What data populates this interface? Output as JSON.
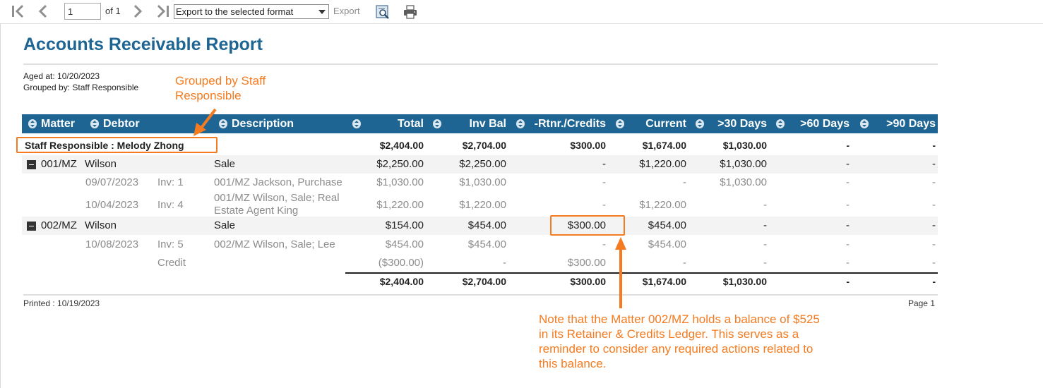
{
  "toolbar": {
    "page_value": "1",
    "of_pages": "of 1",
    "export_format": "Export to the selected format",
    "export_label": "Export"
  },
  "report": {
    "title": "Accounts Receivable Report",
    "aged_at": "Aged at: 10/20/2023",
    "grouped_by": "Grouped by: Staff Responsible"
  },
  "columns": [
    "Matter",
    "Debtor",
    "Description",
    "Total",
    "Inv Bal",
    "-Rtnr./Credits",
    "Current",
    ">30 Days",
    ">60 Days",
    ">90 Days"
  ],
  "group": {
    "label": "Staff Responsible : Melody Zhong",
    "values": [
      "$2,404.00",
      "$2,704.00",
      "$300.00",
      "$1,674.00",
      "$1,030.00",
      "-",
      "-"
    ]
  },
  "matters": [
    {
      "matter": "001/MZ",
      "debtor": "Wilson",
      "description": "Sale",
      "values": [
        "$2,250.00",
        "$2,250.00",
        "-",
        "$1,220.00",
        "$1,030.00",
        "-",
        "-"
      ],
      "lines": [
        {
          "date": "09/07/2023",
          "inv": "Inv: 1",
          "description": [
            "001/MZ Jackson, Purchase"
          ],
          "values": [
            "$1,030.00",
            "$1,030.00",
            "-",
            "-",
            "$1,030.00",
            "-",
            "-"
          ]
        },
        {
          "date": "10/04/2023",
          "inv": "Inv: 4",
          "description": [
            "001/MZ Wilson, Sale; Real",
            "Estate Agent King"
          ],
          "values": [
            "$1,220.00",
            "$1,220.00",
            "-",
            "$1,220.00",
            "-",
            "-",
            "-"
          ]
        }
      ]
    },
    {
      "matter": "002/MZ",
      "debtor": "Wilson",
      "description": "Sale",
      "values": [
        "$154.00",
        "$454.00",
        "$300.00",
        "$454.00",
        "-",
        "-",
        "-"
      ],
      "lines": [
        {
          "date": "10/08/2023",
          "inv": "Inv: 5",
          "description": [
            "002/MZ Wilson, Sale; Lee"
          ],
          "values": [
            "$454.00",
            "$454.00",
            "-",
            "$454.00",
            "-",
            "-",
            "-"
          ]
        },
        {
          "date": "",
          "inv": "Credit",
          "description": [
            ""
          ],
          "values": [
            "($300.00)",
            "-",
            "$300.00",
            "-",
            "-",
            "-",
            "-"
          ]
        }
      ]
    }
  ],
  "totals": [
    "$2,404.00",
    "$2,704.00",
    "$300.00",
    "$1,674.00",
    "$1,030.00",
    "-",
    "-"
  ],
  "footer": {
    "printed": "Printed : 10/19/2023",
    "page": "Page 1"
  },
  "annotations": {
    "grouped": [
      "Grouped by Staff",
      "Responsible"
    ],
    "note": [
      "Note that the Matter 002/MZ holds a balance of $525",
      "in its Retainer & Credits Ledger. This serves as a",
      "reminder to consider any required actions related to",
      "this balance."
    ]
  },
  "colors": {
    "header_blue": "#1e6593",
    "annotation_orange": "#f47b20",
    "row_shade": "#f3f3f3"
  },
  "icons": [
    "first-page-icon",
    "prev-page-icon",
    "next-page-icon",
    "last-page-icon",
    "preview-icon",
    "print-icon"
  ]
}
